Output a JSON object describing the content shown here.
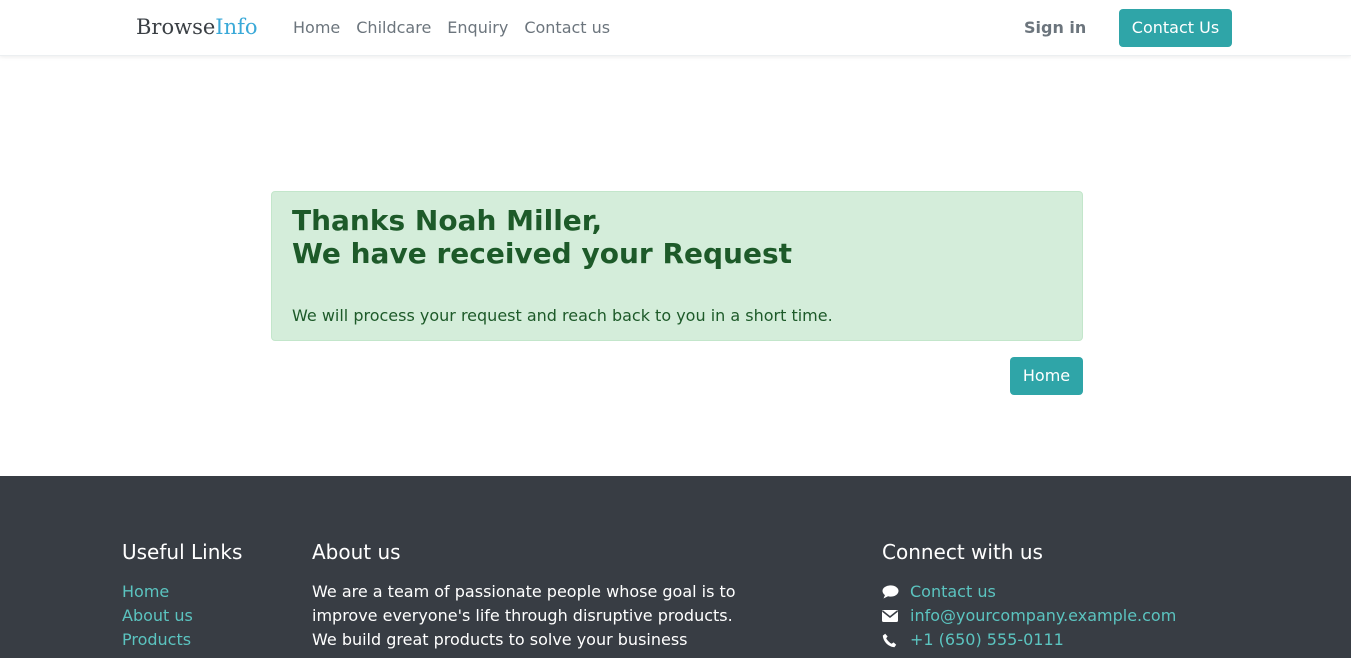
{
  "navbar": {
    "brand_part1": "Browse",
    "brand_part2": "Info",
    "links": [
      "Home",
      "Childcare",
      "Enquiry",
      "Contact us"
    ],
    "signin_label": "Sign in",
    "contact_button_label": "Contact Us"
  },
  "alert": {
    "title_line1": "Thanks Noah Miller,",
    "title_line2": "We have received your Request",
    "message": "We will process your request and reach back to you in a short time."
  },
  "home_button_label": "Home",
  "footer": {
    "useful_links": {
      "heading": "Useful Links",
      "items": [
        "Home",
        "About us",
        "Products"
      ]
    },
    "about": {
      "heading": "About us",
      "text": "We are a team of passionate people whose goal is to improve everyone's life through disruptive products. We build great products to solve your business"
    },
    "connect": {
      "heading": "Connect with us",
      "items": [
        {
          "icon": "comment-icon",
          "label": "Contact us"
        },
        {
          "icon": "envelope-icon",
          "label": "info@yourcompany.example.com"
        },
        {
          "icon": "phone-icon",
          "label": "+1 (650) 555-0111"
        }
      ]
    }
  },
  "colors": {
    "accent": "#2fa5a8",
    "brand_info": "#3aa9d8",
    "alert_bg": "#d4edda",
    "alert_text": "#1d5a29",
    "footer_bg": "#383d44",
    "footer_link": "#5bc4c0"
  }
}
